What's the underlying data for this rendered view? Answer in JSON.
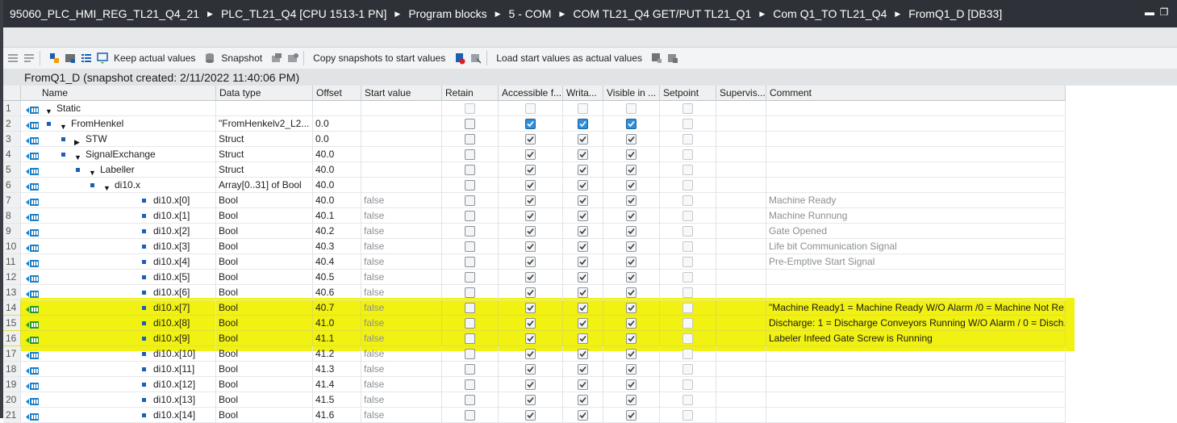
{
  "breadcrumb": [
    "95060_PLC_HMI_REG_TL21_Q4_21",
    "PLC_TL21_Q4 [CPU 1513-1 PN]",
    "Program blocks",
    "5 - COM",
    "COM TL21_Q4  GET/PUT TL21_Q1",
    "Com Q1_TO TL21_Q4",
    "FromQ1_D [DB33]"
  ],
  "toolbar": {
    "keep_actual_label": "Keep actual values",
    "snapshot_label": "Snapshot",
    "copy_snapshots_label": "Copy snapshots to start values",
    "load_start_label": "Load start values as actual values"
  },
  "block_title": "FromQ1_D (snapshot created: 2/11/2022 11:40:06 PM)",
  "columns": [
    "Name",
    "Data type",
    "Offset",
    "Start value",
    "Retain",
    "Accessible f...",
    "Writa...",
    "Visible in ...",
    "Setpoint",
    "Supervis...",
    "Comment"
  ],
  "rows": [
    {
      "num": "1",
      "name": "Static",
      "type": "",
      "offset": "",
      "start": "",
      "comment": "",
      "level": 0,
      "arrow": "▼",
      "dot": false,
      "chk": [
        false,
        false,
        false,
        false,
        false
      ],
      "dim": true,
      "blue": false
    },
    {
      "num": "2",
      "name": "FromHenkel",
      "type": "\"FromHenkelv2_L2...",
      "offset": "0.0",
      "start": "",
      "comment": "",
      "level": 1,
      "arrow": "▼",
      "dot": true,
      "chk": [
        false,
        true,
        true,
        true,
        false
      ],
      "dim": false,
      "blue": true
    },
    {
      "num": "3",
      "name": "STW",
      "type": "Struct",
      "offset": "0.0",
      "start": "",
      "comment": "",
      "level": 2,
      "arrow": "▶",
      "dot": true,
      "chk": [
        false,
        true,
        true,
        true,
        false
      ],
      "dim": false,
      "blue": false
    },
    {
      "num": "4",
      "name": "SignalExchange",
      "type": "Struct",
      "offset": "40.0",
      "start": "",
      "comment": "",
      "level": 2,
      "arrow": "▼",
      "dot": true,
      "chk": [
        false,
        true,
        true,
        true,
        false
      ],
      "dim": false,
      "blue": false
    },
    {
      "num": "5",
      "name": "Labeller",
      "type": "Struct",
      "offset": "40.0",
      "start": "",
      "comment": "",
      "level": 3,
      "arrow": "▼",
      "dot": true,
      "chk": [
        false,
        true,
        true,
        true,
        false
      ],
      "dim": false,
      "blue": false
    },
    {
      "num": "6",
      "name": "di10.x",
      "type": "Array[0..31] of Bool",
      "offset": "40.0",
      "start": "",
      "comment": "",
      "level": 4,
      "arrow": "▼",
      "dot": true,
      "chk": [
        false,
        true,
        true,
        true,
        false
      ],
      "dim": false,
      "blue": false
    },
    {
      "num": "7",
      "name": "di10.x[0]",
      "type": "Bool",
      "offset": "40.0",
      "start": "false",
      "comment": "Machine Ready",
      "level": 5,
      "arrow": "",
      "dot": true,
      "chk": [
        false,
        true,
        true,
        true,
        false
      ],
      "dim": false,
      "blue": false
    },
    {
      "num": "8",
      "name": "di10.x[1]",
      "type": "Bool",
      "offset": "40.1",
      "start": "false",
      "comment": "Machine Runnung",
      "level": 5,
      "arrow": "",
      "dot": true,
      "chk": [
        false,
        true,
        true,
        true,
        false
      ],
      "dim": false,
      "blue": false
    },
    {
      "num": "9",
      "name": "di10.x[2]",
      "type": "Bool",
      "offset": "40.2",
      "start": "false",
      "comment": "Gate Opened",
      "level": 5,
      "arrow": "",
      "dot": true,
      "chk": [
        false,
        true,
        true,
        true,
        false
      ],
      "dim": false,
      "blue": false
    },
    {
      "num": "10",
      "name": "di10.x[3]",
      "type": "Bool",
      "offset": "40.3",
      "start": "false",
      "comment": "Life bit Communication Signal",
      "level": 5,
      "arrow": "",
      "dot": true,
      "chk": [
        false,
        true,
        true,
        true,
        false
      ],
      "dim": false,
      "blue": false
    },
    {
      "num": "11",
      "name": "di10.x[4]",
      "type": "Bool",
      "offset": "40.4",
      "start": "false",
      "comment": "Pre-Emptive Start Signal",
      "level": 5,
      "arrow": "",
      "dot": true,
      "chk": [
        false,
        true,
        true,
        true,
        false
      ],
      "dim": false,
      "blue": false
    },
    {
      "num": "12",
      "name": "di10.x[5]",
      "type": "Bool",
      "offset": "40.5",
      "start": "false",
      "comment": "",
      "level": 5,
      "arrow": "",
      "dot": true,
      "chk": [
        false,
        true,
        true,
        true,
        false
      ],
      "dim": false,
      "blue": false
    },
    {
      "num": "13",
      "name": "di10.x[6]",
      "type": "Bool",
      "offset": "40.6",
      "start": "false",
      "comment": "",
      "level": 5,
      "arrow": "",
      "dot": true,
      "chk": [
        false,
        true,
        true,
        true,
        false
      ],
      "dim": false,
      "blue": false
    },
    {
      "num": "14",
      "name": "di10.x[7]",
      "type": "Bool",
      "offset": "40.7",
      "start": "false",
      "comment": "\"Machine Ready1 = Machine Ready W/O Alarm /0 = Machine Not Re...",
      "level": 5,
      "arrow": "",
      "dot": true,
      "chk": [
        false,
        true,
        true,
        true,
        false
      ],
      "dim": false,
      "blue": false,
      "hl": true
    },
    {
      "num": "15",
      "name": "di10.x[8]",
      "type": "Bool",
      "offset": "41.0",
      "start": "false",
      "comment": "Discharge: 1 = Discharge Conveyors Running W/O Alarm / 0 = Disch.",
      "level": 5,
      "arrow": "",
      "dot": true,
      "chk": [
        false,
        true,
        true,
        true,
        false
      ],
      "dim": false,
      "blue": false,
      "hl": true
    },
    {
      "num": "16",
      "name": "di10.x[9]",
      "type": "Bool",
      "offset": "41.1",
      "start": "false",
      "comment": " Labeler Infeed Gate Screw is Running",
      "level": 5,
      "arrow": "",
      "dot": true,
      "chk": [
        false,
        true,
        true,
        true,
        false
      ],
      "dim": false,
      "blue": false,
      "hl": true
    },
    {
      "num": "17",
      "name": "di10.x[10]",
      "type": "Bool",
      "offset": "41.2",
      "start": "false",
      "comment": "",
      "level": 5,
      "arrow": "",
      "dot": true,
      "chk": [
        false,
        true,
        true,
        true,
        false
      ],
      "dim": false,
      "blue": false
    },
    {
      "num": "18",
      "name": "di10.x[11]",
      "type": "Bool",
      "offset": "41.3",
      "start": "false",
      "comment": "",
      "level": 5,
      "arrow": "",
      "dot": true,
      "chk": [
        false,
        true,
        true,
        true,
        false
      ],
      "dim": false,
      "blue": false
    },
    {
      "num": "19",
      "name": "di10.x[12]",
      "type": "Bool",
      "offset": "41.4",
      "start": "false",
      "comment": "",
      "level": 5,
      "arrow": "",
      "dot": true,
      "chk": [
        false,
        true,
        true,
        true,
        false
      ],
      "dim": false,
      "blue": false
    },
    {
      "num": "20",
      "name": "di10.x[13]",
      "type": "Bool",
      "offset": "41.5",
      "start": "false",
      "comment": "",
      "level": 5,
      "arrow": "",
      "dot": true,
      "chk": [
        false,
        true,
        true,
        true,
        false
      ],
      "dim": false,
      "blue": false
    },
    {
      "num": "21",
      "name": "di10.x[14]",
      "type": "Bool",
      "offset": "41.6",
      "start": "false",
      "comment": "",
      "level": 5,
      "arrow": "",
      "dot": true,
      "chk": [
        false,
        true,
        true,
        true,
        false
      ],
      "dim": false,
      "blue": false
    }
  ],
  "colors": {
    "highlight": "#f0f000",
    "titlebar": "#2e3138",
    "check_blue": "#2f8fdd",
    "db_icon": "#1a7fc8"
  }
}
